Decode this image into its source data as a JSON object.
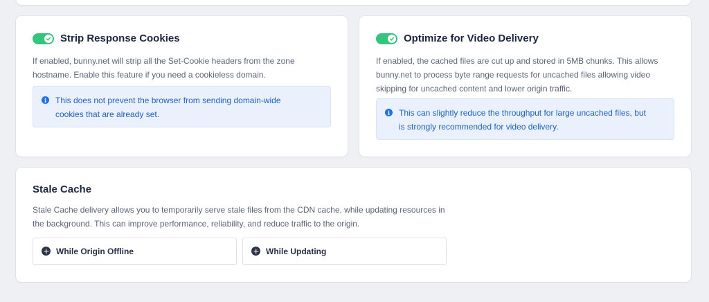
{
  "colors": {
    "toggle_on": "#34c47c",
    "info_bg": "#eaf1fc",
    "info_text": "#1f5fbf",
    "info_icon": "#1f6fe5"
  },
  "strip_cookies": {
    "enabled": true,
    "title": "Strip Response Cookies",
    "description_line1": "If enabled, bunny.net will strip all the Set-Cookie headers from the zone",
    "description_line2": "hostname. Enable this feature if you need a cookieless domain.",
    "info_line1": "This does not prevent the browser from sending domain-wide",
    "info_line2": "cookies that are already set."
  },
  "video_delivery": {
    "enabled": true,
    "title": "Optimize for Video Delivery",
    "description_line1": "If enabled, the cached files are cut up and stored in 5MB chunks. This allows",
    "description_line2": "bunny.net to process byte range requests for uncached files allowing video",
    "description_line3": "skipping for uncached content and lower origin traffic.",
    "info_line1": "This can slightly reduce the throughput for large uncached files, but",
    "info_line2": "is strongly recommended for video delivery."
  },
  "stale_cache": {
    "title": "Stale Cache",
    "description_line1": "Stale Cache delivery allows you to temporarily serve stale files from the CDN cache, while updating resources in",
    "description_line2": "the background. This can improve performance, reliability, and reduce traffic to the origin.",
    "options": [
      {
        "label": "While Origin Offline",
        "icon": "plus-circle-icon"
      },
      {
        "label": "While Updating",
        "icon": "plus-circle-icon"
      }
    ]
  }
}
